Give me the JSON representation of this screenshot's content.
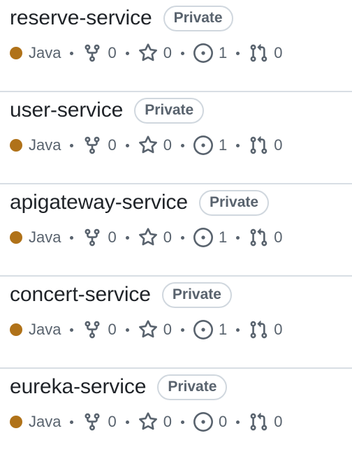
{
  "repos": [
    {
      "name": "reserve-service",
      "visibility": "Private",
      "language": "Java",
      "forks": "0",
      "stars": "0",
      "issues": "1",
      "pulls": "0"
    },
    {
      "name": "user-service",
      "visibility": "Private",
      "language": "Java",
      "forks": "0",
      "stars": "0",
      "issues": "1",
      "pulls": "0"
    },
    {
      "name": "apigateway-service",
      "visibility": "Private",
      "language": "Java",
      "forks": "0",
      "stars": "0",
      "issues": "1",
      "pulls": "0"
    },
    {
      "name": "concert-service",
      "visibility": "Private",
      "language": "Java",
      "forks": "0",
      "stars": "0",
      "issues": "1",
      "pulls": "0"
    },
    {
      "name": "eureka-service",
      "visibility": "Private",
      "language": "Java",
      "forks": "0",
      "stars": "0",
      "issues": "0",
      "pulls": "0"
    }
  ],
  "colors": {
    "java": "#b07219",
    "muted": "#59636e",
    "border": "#d0d7de"
  },
  "icons": {
    "fork": "repo-forked-icon",
    "star": "star-icon",
    "issue": "issue-opened-icon",
    "pull": "git-pull-request-icon"
  }
}
